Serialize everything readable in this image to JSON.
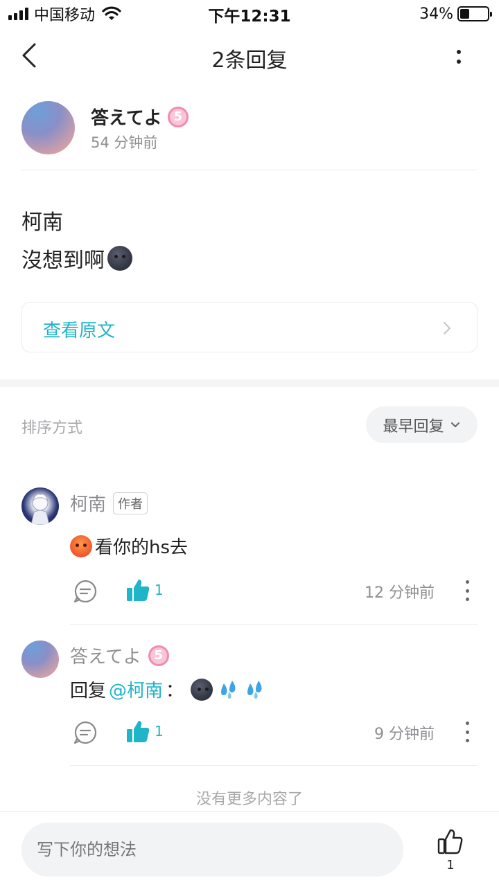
{
  "status_bar": {
    "carrier": "中国移动",
    "time": "下午12:31",
    "battery": "34%",
    "battery_level": 0.34
  },
  "nav": {
    "title": "2条回复"
  },
  "post": {
    "author": "答えてよ",
    "level": "5",
    "time": "54 分钟前",
    "line1": "柯南",
    "line2": "沒想到啊",
    "view_original": "查看原文"
  },
  "sort": {
    "label": "排序方式",
    "value": "最早回复"
  },
  "comments": [
    {
      "name": "柯南",
      "tag": "作者",
      "text": "看你的hs去",
      "likes": "1",
      "time": "12 分钟前"
    },
    {
      "name": "答えてよ",
      "level": "5",
      "reply_prefix": "回复",
      "mention": "@柯南",
      "colon": "：",
      "likes": "1",
      "time": "9 分钟前"
    }
  ],
  "end_text": "没有更多内容了",
  "bottom": {
    "placeholder": "写下你的想法",
    "likes": "1"
  },
  "colors": {
    "accent": "#1fb4c8",
    "muted": "#8e8e93"
  }
}
